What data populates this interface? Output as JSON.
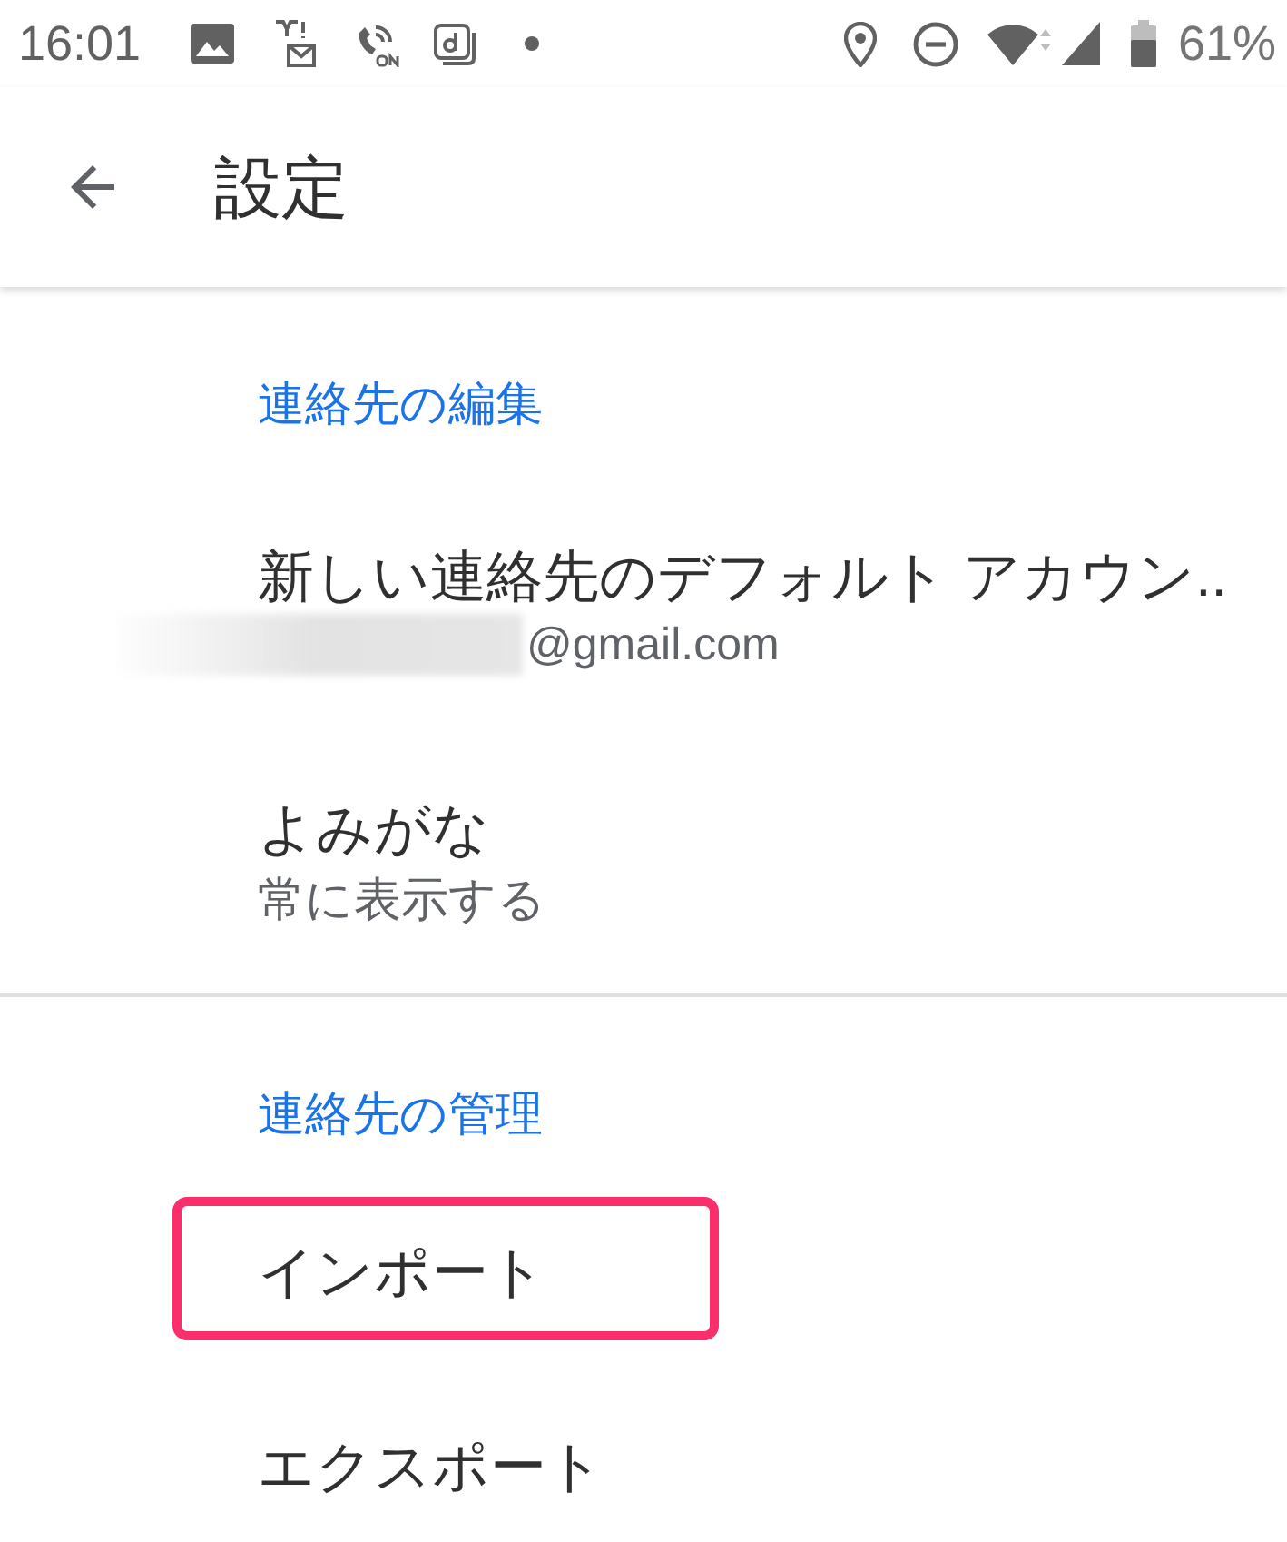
{
  "status_bar": {
    "time": "16:01",
    "battery": "61%"
  },
  "toolbar": {
    "title": "設定"
  },
  "sections": [
    {
      "header": "連絡先の編集",
      "items": [
        {
          "title": "新しい連絡先のデフォルト アカウン..",
          "subtitle": "@gmail.com",
          "redacted": true,
          "highlighted": false
        },
        {
          "title": "よみがな",
          "subtitle": "常に表示する",
          "highlighted": false
        }
      ]
    },
    {
      "header": "連絡先の管理",
      "items": [
        {
          "title": "インポート",
          "highlighted": true
        },
        {
          "title": "エクスポート",
          "highlighted": false
        }
      ]
    }
  ]
}
